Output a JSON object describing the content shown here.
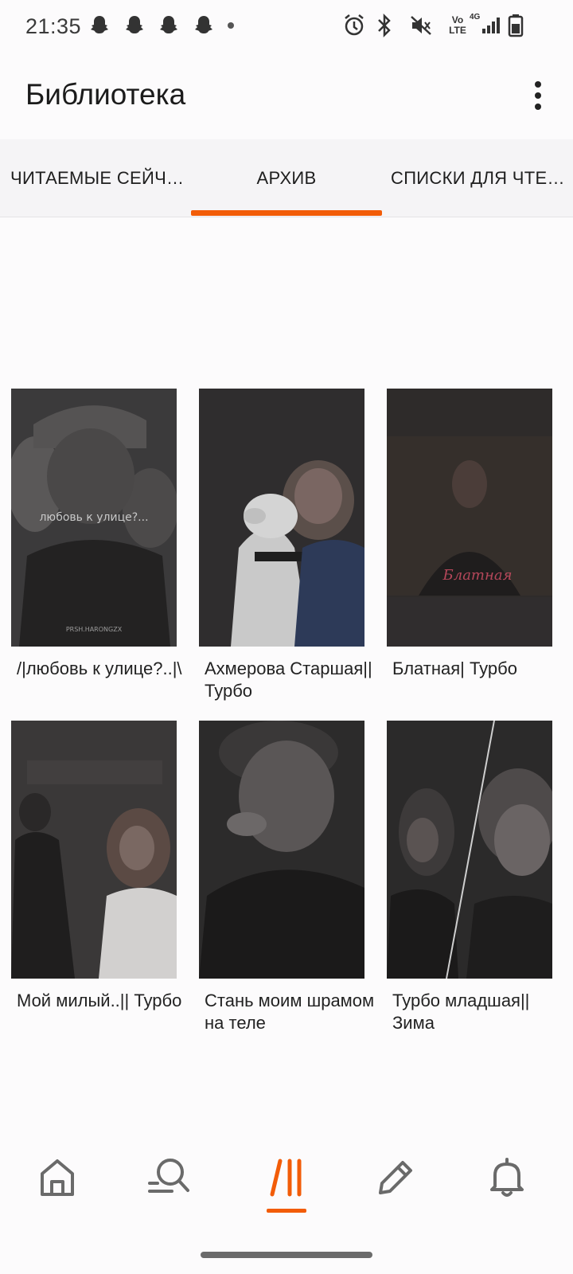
{
  "status_bar": {
    "time": "21:35",
    "notification_icons": [
      "snapchat-icon",
      "snapchat-icon",
      "snapchat-icon",
      "snapchat-icon"
    ],
    "right_icons": [
      "alarm-icon",
      "bluetooth-icon",
      "mute-icon",
      "volte-icon",
      "signal-icon",
      "battery-icon"
    ],
    "volte_top": "Vo",
    "volte_bottom": "LTE",
    "network_label": "4G"
  },
  "app_bar": {
    "title": "Библиотека"
  },
  "tabs": [
    {
      "label": "ЧИТАЕМЫЕ СЕЙЧ…",
      "active": false
    },
    {
      "label": "АРХИВ",
      "active": true
    },
    {
      "label": "СПИСКИ ДЛЯ ЧТЕ…",
      "active": false
    }
  ],
  "colors": {
    "accent": "#f25c08",
    "background": "#fcfbfc",
    "tab_bar": "#f5f4f6"
  },
  "stories": [
    {
      "title": "/|любовь к улице?..|\\",
      "cover_text": "любовь к улице?...",
      "cover_footer": "PRSH.HARONGZX"
    },
    {
      "title": "Ахмерова Старшая||Турбо",
      "cover_text": "",
      "cover_footer": ""
    },
    {
      "title": "Блатная| Турбо",
      "cover_text": "Блатная",
      "cover_footer": ""
    },
    {
      "title": "Мой милый..|| Турбо",
      "cover_text": "",
      "cover_footer": ""
    },
    {
      "title": "Стань моим шрамом на теле",
      "cover_text": "",
      "cover_footer": ""
    },
    {
      "title": "Турбо младшая|| Зима",
      "cover_text": "",
      "cover_footer": ""
    }
  ],
  "bottom_nav": [
    {
      "icon": "home-icon",
      "active": false
    },
    {
      "icon": "search-icon",
      "active": false
    },
    {
      "icon": "library-icon",
      "active": true
    },
    {
      "icon": "write-icon",
      "active": false
    },
    {
      "icon": "notifications-icon",
      "active": false
    }
  ]
}
